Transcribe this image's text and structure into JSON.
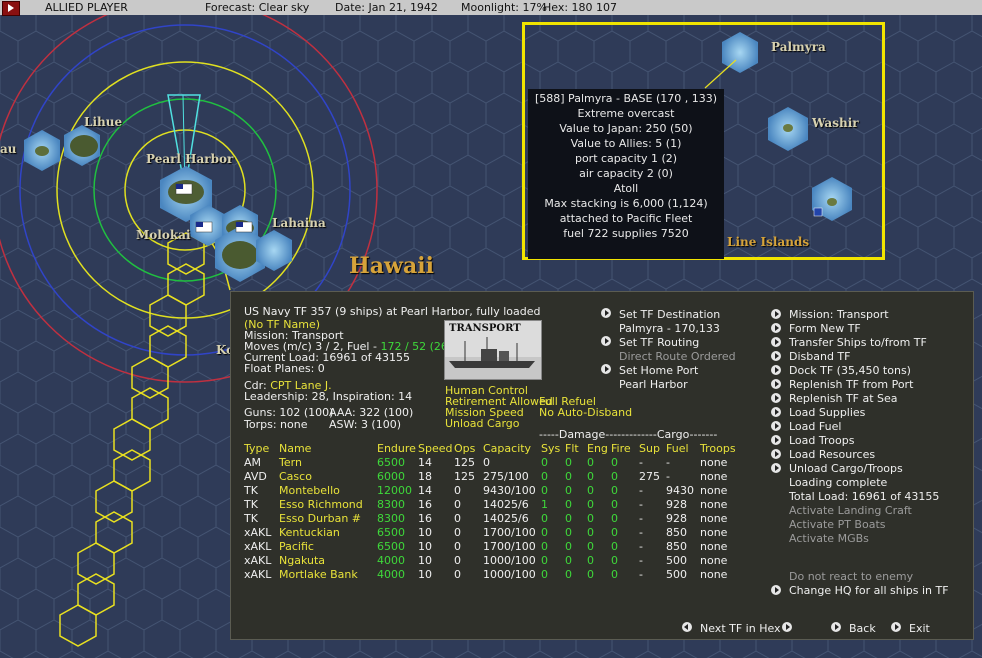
{
  "topbar": {
    "player": "ALLIED PLAYER",
    "forecast": "Forecast: Clear sky",
    "date": "Date:  Jan 21, 1942",
    "moonlight": "Moonlight: 17%",
    "hex": "Hex:  180  107"
  },
  "map": {
    "labels": [
      "Lihue",
      "Pearl Harbor",
      "Molokai",
      "Lahaina",
      "Hawaii",
      "Ko",
      "au",
      "Palmyra",
      "Washir",
      "Line Islands"
    ]
  },
  "tooltip": {
    "lines": [
      "[588] Palmyra  - BASE  (170 , 133)",
      "Extreme overcast",
      "Value to Japan:  250 (50)",
      "Value to Allies:  5 (1)",
      "port capacity  1 (2)",
      "air capacity  2 (0)",
      "Atoll",
      "Max stacking is 6,000  (1,124)",
      "attached to Pacific Fleet",
      "fuel 722  supplies 7520"
    ]
  },
  "tf": {
    "header": "US Navy TF 357 (9 ships) at Pearl Harbor, fully loaded",
    "name": "(No TF Name)",
    "mission": "Mission:  Transport",
    "moves_label": "Moves (m/c)  3 / 2, Fuel -",
    "moves_fuel": "172 / 52 (26)",
    "current_load": "Current Load:  16961 of 43155",
    "float_planes": "Float Planes:  0",
    "cdr_label": "Cdr:",
    "cdr_name": "CPT  Lane J.",
    "leadership": "Leadership: 28, Inspiration: 14",
    "guns": "Guns: 102 (100)",
    "aaa": "AAA: 322 (100)",
    "torps": "Torps: none",
    "asw": "ASW: 3 (100)",
    "ship_image_label": "TRANSPORT",
    "options_left": [
      "Human Control",
      "Retirement Allowed",
      "Mission Speed",
      "Unload Cargo"
    ],
    "options_right": [
      "Full Refuel",
      "No Auto-Disband"
    ]
  },
  "middle_actions": {
    "set_destination": "Set TF Destination",
    "destination_value": "Palmyra - 170,133",
    "set_routing": "Set TF Routing",
    "routing_value": "Direct Route Ordered",
    "set_home": "Set Home Port",
    "home_value": "Pearl Harbor"
  },
  "right_actions": {
    "items": [
      "Mission: Transport",
      "Form New TF",
      "Transfer Ships to/from TF",
      "Disband TF",
      "Dock TF (35,450 tons)",
      "Replenish TF from Port",
      "Replenish TF at Sea",
      "Load Supplies",
      "Load Fuel",
      "Load Troops",
      "Load Resources",
      "Unload Cargo/Troops"
    ],
    "loading_complete": "Loading complete",
    "total_load": "Total Load:  16961 of 43155",
    "inactive": [
      "Activate Landing Craft",
      "Activate PT Boats",
      "Activate MGBs"
    ],
    "no_react": "Do not react to enemy",
    "change_hq": "Change HQ for all ships in TF"
  },
  "table": {
    "damage_header": "-----Damage-------------Cargo-------",
    "headers": [
      "Type",
      "Name",
      "Endure",
      "Speed",
      "Ops",
      "Capacity",
      "Sys",
      "Flt",
      "Eng",
      "Fire",
      "Sup",
      "Fuel",
      "Troops"
    ],
    "rows": [
      [
        "AM",
        "Tern",
        "6500",
        "14",
        "125",
        "0",
        "0",
        "0",
        "0",
        "0",
        "-",
        "-",
        "none"
      ],
      [
        "AVD",
        "Casco",
        "6000",
        "18",
        "125",
        "275/100",
        "0",
        "0",
        "0",
        "0",
        "275",
        "-",
        "none"
      ],
      [
        "TK",
        "Montebello",
        "12000",
        "14",
        "0",
        "9430/100",
        "0",
        "0",
        "0",
        "0",
        "-",
        "9430",
        "none"
      ],
      [
        "TK",
        "Esso Richmond",
        "8300",
        "16",
        "0",
        "14025/6",
        "1",
        "0",
        "0",
        "0",
        "-",
        "928",
        "none"
      ],
      [
        "TK",
        "Esso Durban #",
        "8300",
        "16",
        "0",
        "14025/6",
        "0",
        "0",
        "0",
        "0",
        "-",
        "928",
        "none"
      ],
      [
        "xAKL",
        "Kentuckian",
        "6500",
        "10",
        "0",
        "1700/100",
        "0",
        "0",
        "0",
        "0",
        "-",
        "850",
        "none"
      ],
      [
        "xAKL",
        "Pacific",
        "6500",
        "10",
        "0",
        "1700/100",
        "0",
        "0",
        "0",
        "0",
        "-",
        "850",
        "none"
      ],
      [
        "xAKL",
        "Ngakuta",
        "4000",
        "10",
        "0",
        "1000/100",
        "0",
        "0",
        "0",
        "0",
        "-",
        "500",
        "none"
      ],
      [
        "xAKL",
        "Mortlake Bank",
        "4000",
        "10",
        "0",
        "1000/100",
        "0",
        "0",
        "0",
        "0",
        "-",
        "500",
        "none"
      ]
    ]
  },
  "bottom": {
    "next_tf": "Next TF in Hex",
    "back": "Back",
    "exit": "Exit"
  }
}
